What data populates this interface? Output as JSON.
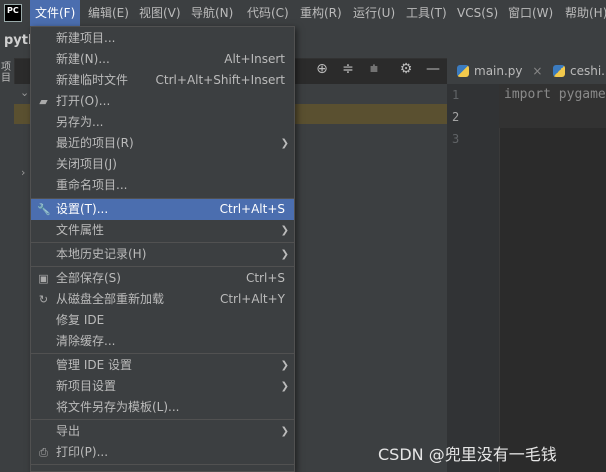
{
  "app": {
    "icon_text": "PC",
    "project_name": "pyth"
  },
  "menubar": {
    "items": [
      "文件(F)",
      "编辑(E)",
      "视图(V)",
      "导航(N)",
      "代码(C)",
      "重构(R)",
      "运行(U)",
      "工具(T)",
      "VCS(S)",
      "窗口(W)",
      "帮助(H)"
    ]
  },
  "side_panel": {
    "tab_label": "项目"
  },
  "editor": {
    "tabs": [
      {
        "label": "main.py"
      },
      {
        "label": "ceshi.py"
      }
    ],
    "line_numbers": [
      "1",
      "2",
      "3"
    ],
    "code_line_1": "import pygame"
  },
  "file_menu": {
    "items": [
      {
        "label": "新建项目...",
        "shortcut": ""
      },
      {
        "label": "新建(N)...",
        "shortcut": "Alt+Insert"
      },
      {
        "label": "新建临时文件",
        "shortcut": "Ctrl+Alt+Shift+Insert"
      },
      {
        "label": "打开(O)...",
        "shortcut": ""
      },
      {
        "label": "另存为...",
        "shortcut": ""
      },
      {
        "label": "最近的项目(R)",
        "shortcut": ""
      },
      {
        "label": "关闭项目(J)",
        "shortcut": ""
      },
      {
        "label": "重命名项目...",
        "shortcut": ""
      },
      {
        "label": "设置(T)...",
        "shortcut": "Ctrl+Alt+S"
      },
      {
        "label": "文件属性",
        "shortcut": ""
      },
      {
        "label": "本地历史记录(H)",
        "shortcut": ""
      },
      {
        "label": "全部保存(S)",
        "shortcut": "Ctrl+S"
      },
      {
        "label": "从磁盘全部重新加载",
        "shortcut": "Ctrl+Alt+Y"
      },
      {
        "label": "修复 IDE",
        "shortcut": ""
      },
      {
        "label": "清除缓存...",
        "shortcut": ""
      },
      {
        "label": "管理 IDE 设置",
        "shortcut": ""
      },
      {
        "label": "新项目设置",
        "shortcut": ""
      },
      {
        "label": "将文件另存为模板(L)...",
        "shortcut": ""
      },
      {
        "label": "导出",
        "shortcut": ""
      },
      {
        "label": "打印(P)...",
        "shortcut": ""
      }
    ]
  },
  "watermark": "CSDN @兜里没有一毛钱"
}
